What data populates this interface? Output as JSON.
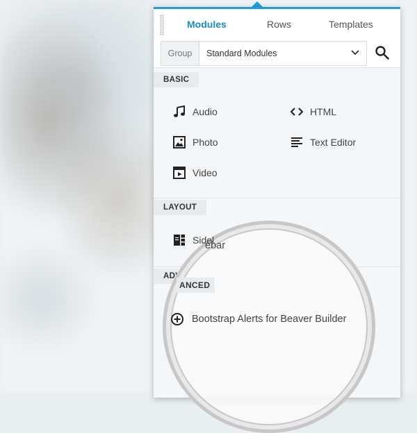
{
  "tabs": [
    {
      "label": "Modules",
      "active": true
    },
    {
      "label": "Rows",
      "active": false
    },
    {
      "label": "Templates",
      "active": false
    }
  ],
  "group": {
    "label": "Group",
    "value": "Standard Modules"
  },
  "sections": {
    "basic": {
      "title": "BASIC",
      "modules": [
        {
          "label": "Audio",
          "icon": "music-icon"
        },
        {
          "label": "HTML",
          "icon": "code-icon"
        },
        {
          "label": "Photo",
          "icon": "photo-icon"
        },
        {
          "label": "Text Editor",
          "icon": "text-editor-icon"
        },
        {
          "label": "Video",
          "icon": "video-icon"
        }
      ]
    },
    "layout": {
      "title": "LAYOUT",
      "modules": [
        {
          "label_left": "Sidel",
          "label_right": "ebar",
          "icon": "sidebar-icon"
        }
      ]
    },
    "advanced": {
      "title_left": "ADV",
      "title_right": "ANCED",
      "modules": [
        {
          "label": "Bootstrap Alerts for Beaver Builder",
          "icon": "plus-circle-icon"
        }
      ]
    }
  },
  "colors": {
    "accent": "#1e9fd6",
    "active_tab": "#1e8cc4"
  }
}
